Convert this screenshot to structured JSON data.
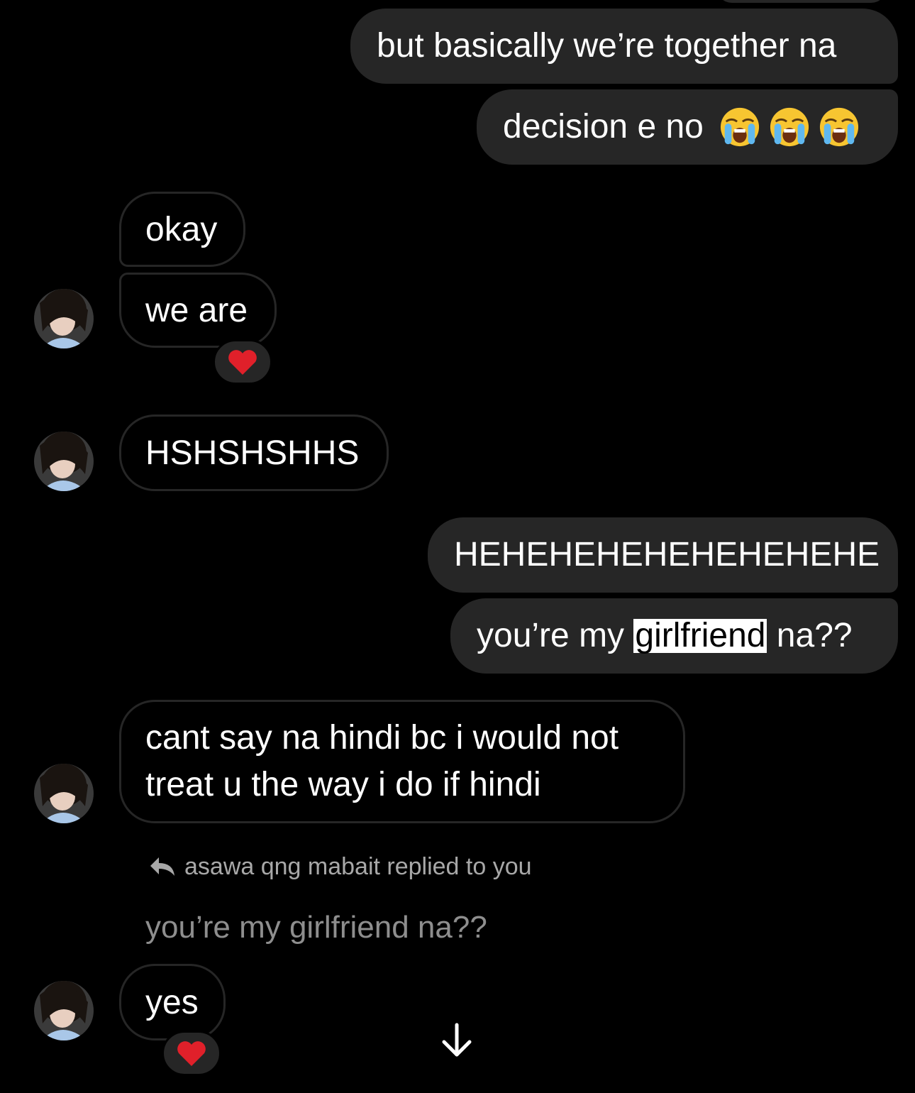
{
  "messages": {
    "m1": "but basically we’re together na",
    "m2": "decision e no",
    "m3": "okay",
    "m4": "we are",
    "m5": "HSHSHSHHS",
    "m6": "HEHEHEHEHEHEHEHEHE",
    "m7_before": "you’re my ",
    "m7_highlight": "girlfriend",
    "m7_after": " na??",
    "m8_line1": "cant say na hindi bc i would not",
    "m8_line2": "treat u the way i do if hindi",
    "m9": "yes"
  },
  "reply": {
    "label": "asawa qng mabait replied to you",
    "quoted": "you’re my girlfriend na??"
  },
  "reactions": {
    "m4": "heart",
    "m9": "heart"
  },
  "icons": {
    "reply": "reply-arrow-icon",
    "scroll": "arrow-down-icon",
    "cry": "loudly-crying-face-icon",
    "heart": "red-heart-icon"
  },
  "colors": {
    "background": "#000000",
    "outgoing_bubble": "#262626",
    "incoming_border": "#262626",
    "heart": "#e0202a"
  }
}
